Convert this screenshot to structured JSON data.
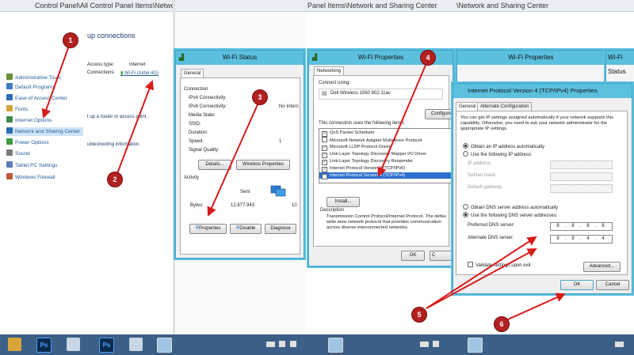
{
  "panels": {
    "p1": {
      "breadcrumb": "Control Panel\\All Control Panel Items\\Network and Sharing Center",
      "heading": "up connections"
    },
    "p2": {
      "breadcrumb": "Panel Items\\Network and Sharing Center"
    },
    "p3": {
      "breadcrumb": "\\Network and Sharing Center"
    }
  },
  "sidebar": {
    "items": [
      {
        "label": "Administrative Tools",
        "color": "#6a8f3a"
      },
      {
        "label": "Default Programs",
        "color": "#3d7bbf"
      },
      {
        "label": "Ease of Access Center",
        "color": "#2f6fb8"
      },
      {
        "label": "Fonts",
        "color": "#d4a23a"
      },
      {
        "label": "Internet Options",
        "color": "#3d8a4a"
      },
      {
        "label": "Network and Sharing Center",
        "color": "#2a6fb0"
      },
      {
        "label": "Power Options",
        "color": "#3f9a3f"
      },
      {
        "label": "Sound",
        "color": "#7a7a7a"
      },
      {
        "label": "Tablet PC Settings",
        "color": "#5a7fb5"
      },
      {
        "label": "Windows Firewall",
        "color": "#c0583a"
      }
    ]
  },
  "network_info": {
    "access_label": "Access type:",
    "access_value": "Internet",
    "connections_label": "Connections:",
    "connections_value": "Wi-Fi (Airtel 4G)"
  },
  "main_texts": {
    "setup_text": "t up a router or access point.",
    "troubleshoot_text": "ubleshooting information."
  },
  "wifi_status": {
    "title": "Wi-Fi Status",
    "tab": "General",
    "connection_header": "Connection",
    "rows": [
      {
        "label": "IPv4 Connectivity:",
        "value": ""
      },
      {
        "label": "IPv6 Connectivity:",
        "value": "No Intern"
      },
      {
        "label": "Media State:",
        "value": ""
      },
      {
        "label": "SSID:",
        "value": ""
      },
      {
        "label": "Duration:",
        "value": ""
      },
      {
        "label": "Speed:",
        "value": "1"
      }
    ],
    "signal_label": "Signal Quality:",
    "details_btn": "Details...",
    "wireless_props_btn": "Wireless Properties",
    "activity_header": "Activity",
    "sent_label": "Sent",
    "bytes_label": "Bytes:",
    "bytes_sent": "12,877,943",
    "bytes_recv": "10",
    "properties_btn": "Properties",
    "disable_btn": "Disable",
    "diagnose_btn": "Diagnose"
  },
  "wifi_props": {
    "title": "Wi-Fi Properties",
    "tab": "Networking",
    "connect_label": "Connect using:",
    "adapter": "Dell Wireless 1560 802.11ac",
    "configure_btn": "Configure",
    "items_label": "This connection uses the following items:",
    "items": [
      {
        "label": "QoS Packet Scheduler",
        "checked": true
      },
      {
        "label": "Microsoft Network Adapter Multiplexor Protocol",
        "checked": false
      },
      {
        "label": "Microsoft LLDP Protocol Driver",
        "checked": true
      },
      {
        "label": "Link-Layer Topology Discovery Mapper I/O Driver",
        "checked": true
      },
      {
        "label": "Link-Layer Topology Discovery Responder",
        "checked": true
      },
      {
        "label": "Internet Protocol Version 6 (TCP/IPv6)",
        "checked": true
      },
      {
        "label": "Internet Protocol Version 4 (TCP/IPv4)",
        "checked": true,
        "selected": true
      }
    ],
    "install_btn": "Install...",
    "description_label": "Description",
    "description": "Transmission Control Protocol/Internet Protocol. The defau wide area network protocol that provides communication across diverse interconnected networks.",
    "ok_btn": "OK",
    "cancel_partial": "C"
  },
  "wifi_props_bg": {
    "title": "Wi-Fi Properties",
    "title2": "Wi-Fi Status"
  },
  "ipv4": {
    "title": "Internet Protocol Version 4 (TCP/IPv4) Properties",
    "tabs": [
      "General",
      "Alternate Configuration"
    ],
    "intro": "You can get IP settings assigned automatically if your network supports this capability. Otherwise, you need to ask your network administrator for the appropriate IP settings.",
    "auto_ip": "Obtain an IP address automatically",
    "manual_ip": "Use the following IP address:",
    "ip_label": "IP address:",
    "subnet_label": "Subnet mask:",
    "gateway_label": "Default gateway:",
    "auto_dns": "Obtain DNS server address automatically",
    "manual_dns": "Use the following DNS server addresses:",
    "pref_label": "Preferred DNS server:",
    "pref_value": [
      "8",
      "8",
      "8",
      "8"
    ],
    "alt_label": "Alternate DNS server:",
    "alt_value": [
      "8",
      "8",
      "4",
      "4"
    ],
    "validate": "Validate settings upon exit",
    "advanced_btn": "Advanced...",
    "ok_btn": "OK",
    "cancel_btn": "Cancel"
  },
  "badges": [
    "1",
    "2",
    "3",
    "4",
    "5",
    "6"
  ],
  "taskbar": {
    "apps": [
      "explorer",
      "photoshop",
      "control-panel",
      "photoshop",
      "control-panel",
      "network"
    ]
  }
}
